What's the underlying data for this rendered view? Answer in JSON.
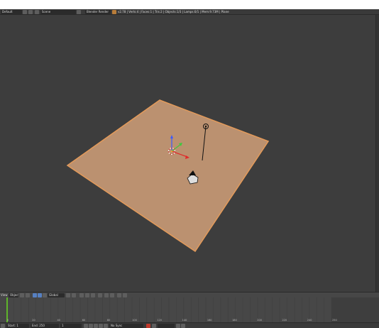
{
  "top_header": {
    "editor_type_label": "Default",
    "scene_label": "Scene",
    "render_engine": "Blender Render",
    "stats": "v2.78 | Verts:4 | Faces:1 | Tris:2 | Objects:1/3 | Lamps:0/1 | Mem:9.73M | Plane"
  },
  "viewport_header": {
    "view_label": "View",
    "mode_label": "Object Mode",
    "global_label": "Global"
  },
  "timeline": {
    "ruler_labels": [
      "0",
      "20",
      "40",
      "60",
      "80",
      "100",
      "120",
      "140",
      "160",
      "180",
      "200",
      "220",
      "240",
      "250"
    ]
  },
  "bottom_header": {
    "start_label": "Start:",
    "start_value": "1",
    "end_label": "End:",
    "end_value": "250",
    "current_frame": "1",
    "sync_label": "No Sync"
  },
  "colors": {
    "viewport_bg": "#3d3d3d",
    "plane_fill": "#bb9170",
    "plane_outline": "#e39a5a",
    "header_bg": "#3a3a3a",
    "timeline_bg": "#474747",
    "current_frame_marker": "#5fb52b",
    "axis_x": "#e02a2a",
    "axis_y": "#3ec83e",
    "axis_z": "#3a5aff"
  },
  "icons": [
    "view3d-icon",
    "scene-icon",
    "render-engine-icon",
    "blender-logo-icon",
    "camera-icon",
    "lamp-icon",
    "axis-manipulator-icon",
    "object-origin-icon",
    "3d-cursor-icon",
    "play-icon",
    "record-icon",
    "keyframe-icon"
  ]
}
